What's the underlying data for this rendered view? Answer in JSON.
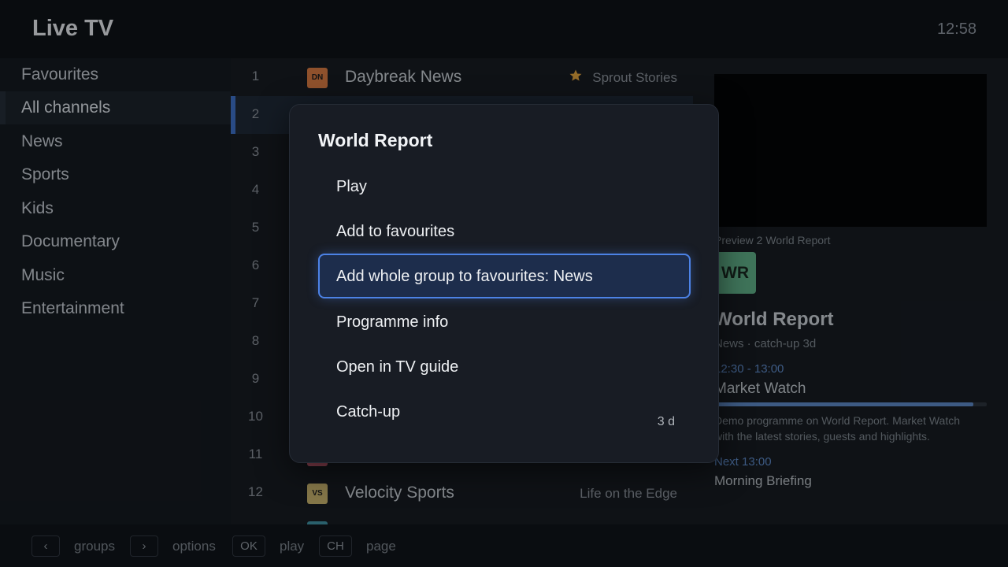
{
  "header": {
    "title": "Live TV",
    "clock": "12:58"
  },
  "groups": [
    {
      "label": "Favourites",
      "active": false
    },
    {
      "label": "All channels",
      "active": true
    },
    {
      "label": "News",
      "active": false
    },
    {
      "label": "Sports",
      "active": false
    },
    {
      "label": "Kids",
      "active": false
    },
    {
      "label": "Documentary",
      "active": false
    },
    {
      "label": "Music",
      "active": false
    },
    {
      "label": "Entertainment",
      "active": false
    }
  ],
  "channels": [
    {
      "num": "1",
      "logo": "DN",
      "logo_color": "#d9783e",
      "name": "Daybreak News",
      "now": "Sprout Stories",
      "favourite": true
    },
    {
      "num": "2",
      "selected": true
    },
    {
      "num": "3"
    },
    {
      "num": "4"
    },
    {
      "num": "5"
    },
    {
      "num": "6"
    },
    {
      "num": "7"
    },
    {
      "num": "8"
    },
    {
      "num": "9"
    },
    {
      "num": "10"
    },
    {
      "num": "11",
      "logo_color": "#c45a6e"
    },
    {
      "num": "12",
      "logo": "VS",
      "logo_color": "#c9b36a",
      "name": "Velocity Sports",
      "now": "Life on the Edge"
    },
    {
      "logo_color": "#3e8fa0"
    }
  ],
  "colors": {
    "accent": "#4c82e6",
    "favourite_star": "#e2a13a"
  },
  "preview": {
    "label": "Preview 2 World Report",
    "logo": "WR",
    "name": "World Report",
    "meta": "News · catch-up 3d",
    "time": "12:30 - 13:00",
    "programme": "Market Watch",
    "progress_percent": 95,
    "description": "Demo programme on World Report. Market Watch with the latest stories, guests and highlights.",
    "next_time": "Next 13:00",
    "next_programme": "Morning Briefing"
  },
  "modal": {
    "title": "World Report",
    "options": [
      {
        "label": "Play"
      },
      {
        "label": "Add to favourites"
      },
      {
        "label": "Add whole group to favourites: News",
        "focused": true
      },
      {
        "label": "Programme info"
      },
      {
        "label": "Open in TV guide"
      },
      {
        "label": "Catch-up",
        "badge": "3 d"
      }
    ]
  },
  "footer": {
    "hints": [
      {
        "key": "‹",
        "label": "groups"
      },
      {
        "key": "›",
        "label": "options"
      },
      {
        "key": "OK",
        "label": "play"
      },
      {
        "key": "CH",
        "label": "page"
      }
    ]
  }
}
